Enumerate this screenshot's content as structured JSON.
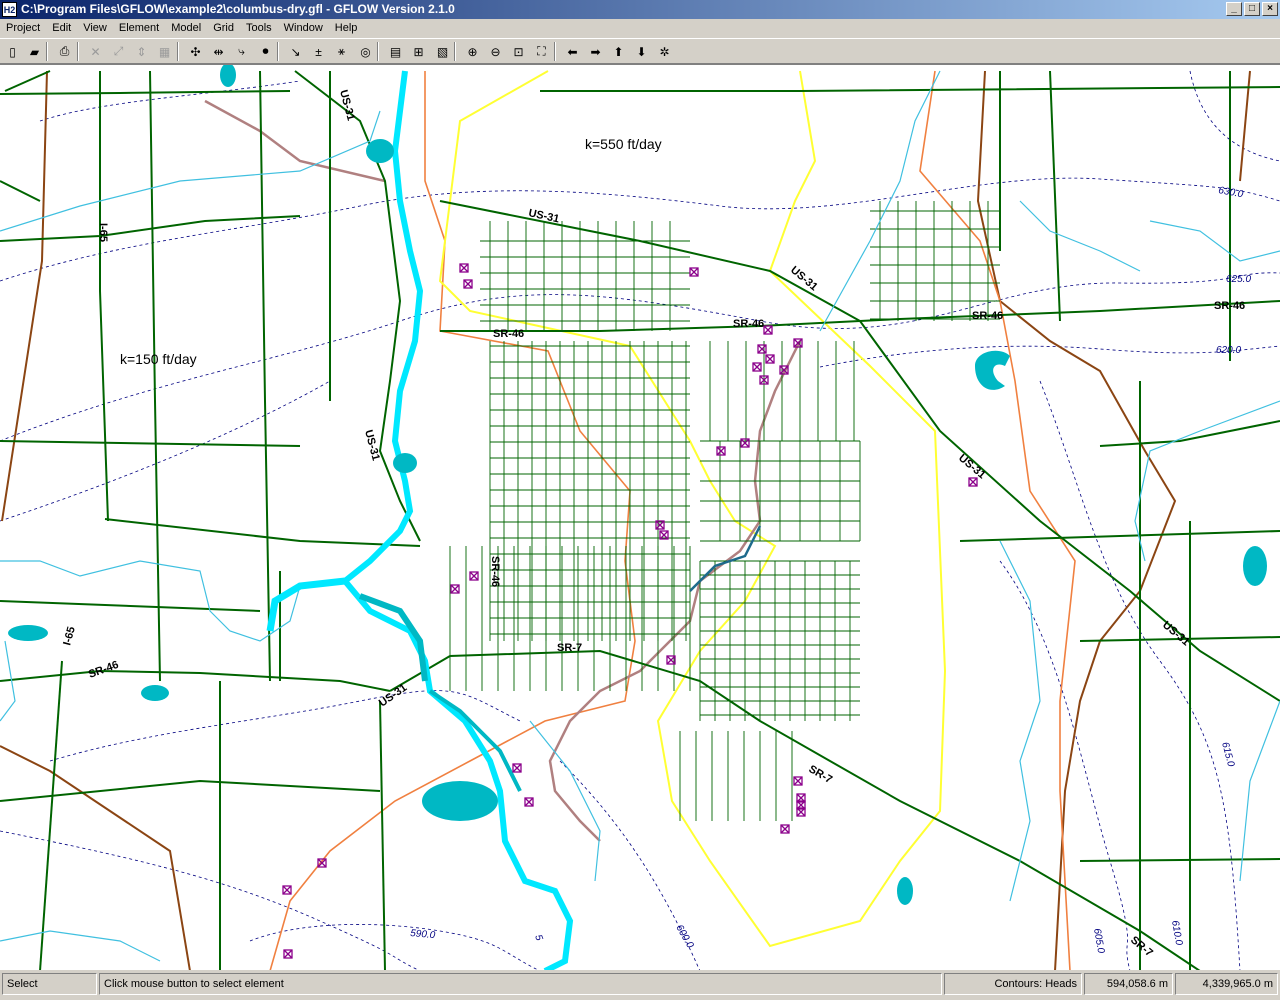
{
  "window": {
    "title": "C:\\Program Files\\GFLOW\\example2\\columbus-dry.gfl - GFLOW Version 2.1.0",
    "app_icon": "H2",
    "controls": {
      "minimize": "_",
      "restore": "□",
      "close": "×"
    }
  },
  "menu": [
    "Project",
    "Edit",
    "View",
    "Element",
    "Model",
    "Grid",
    "Tools",
    "Window",
    "Help"
  ],
  "toolbar": [
    {
      "name": "new-icon",
      "glyph": "▯",
      "enabled": true
    },
    {
      "name": "open-folder-icon",
      "glyph": "▰",
      "enabled": true
    },
    {
      "name": "print-icon",
      "glyph": "⎙",
      "enabled": true
    },
    {
      "name": "delete-icon",
      "glyph": "✕",
      "enabled": false
    },
    {
      "name": "move-icon",
      "glyph": "⤢",
      "enabled": false
    },
    {
      "name": "insert-icon",
      "glyph": "⇕",
      "enabled": false
    },
    {
      "name": "layer-icon",
      "glyph": "▦",
      "enabled": false
    },
    {
      "name": "well-icon",
      "glyph": "✣",
      "enabled": true
    },
    {
      "name": "linesink-icon",
      "glyph": "⇹",
      "enabled": true
    },
    {
      "name": "drain-icon",
      "glyph": "⤷",
      "enabled": true
    },
    {
      "name": "tape-icon",
      "glyph": "⏺",
      "enabled": true
    },
    {
      "name": "pathline-icon",
      "glyph": "↘",
      "enabled": true
    },
    {
      "name": "add-question-icon",
      "glyph": "±",
      "enabled": true
    },
    {
      "name": "tracing-icon",
      "glyph": "⚹",
      "enabled": true
    },
    {
      "name": "globe-icon",
      "glyph": "◎",
      "enabled": true
    },
    {
      "name": "calculator-icon",
      "glyph": "▤",
      "enabled": true
    },
    {
      "name": "grid-icon",
      "glyph": "⊞",
      "enabled": true
    },
    {
      "name": "image-icon",
      "glyph": "▧",
      "enabled": true
    },
    {
      "name": "zoom-in-icon",
      "glyph": "⊕",
      "enabled": true
    },
    {
      "name": "zoom-out-icon",
      "glyph": "⊖",
      "enabled": true
    },
    {
      "name": "zoom-window-icon",
      "glyph": "⊡",
      "enabled": true
    },
    {
      "name": "zoom-extent-icon",
      "glyph": "⛶",
      "enabled": true
    },
    {
      "name": "pan-left-icon",
      "glyph": "⬅",
      "enabled": true
    },
    {
      "name": "pan-right-icon",
      "glyph": "➡",
      "enabled": true
    },
    {
      "name": "pan-up-icon",
      "glyph": "⬆",
      "enabled": true
    },
    {
      "name": "pan-down-icon",
      "glyph": "⬇",
      "enabled": true
    },
    {
      "name": "center-icon",
      "glyph": "✲",
      "enabled": true
    }
  ],
  "map": {
    "labels": {
      "zone_k550": "k=550 ft/day",
      "zone_k150": "k=150 ft/day"
    },
    "roads": [
      "US-31",
      "US-31",
      "US-31",
      "US-31",
      "US-31",
      "US-31",
      "US-31",
      "I-65",
      "I-65",
      "SR-46",
      "SR-46",
      "SR-46",
      "SR-46",
      "SR-46",
      "SR-46",
      "SR-7",
      "SR-7",
      "SR-7"
    ],
    "contours": [
      "630.0",
      "625.0",
      "620.0",
      "615.0",
      "610.0",
      "605.0",
      "600.0",
      "590.0",
      "5"
    ],
    "colors": {
      "roads": "#006400",
      "river": "#00e8ff",
      "lakes": "#00b8c4",
      "streams": "#40c0e0",
      "zone_boundary": "#ffff33",
      "orange_line": "#f08040",
      "brown_line": "#8b4513",
      "railroad": "#b08080",
      "wells": "#8b008b",
      "contours": "#000080"
    }
  },
  "status": {
    "mode": "Select",
    "hint": "Click mouse button to select element",
    "contours": "Contours: Heads",
    "x": "594,058.6 m",
    "y": "4,339,965.0 m"
  }
}
